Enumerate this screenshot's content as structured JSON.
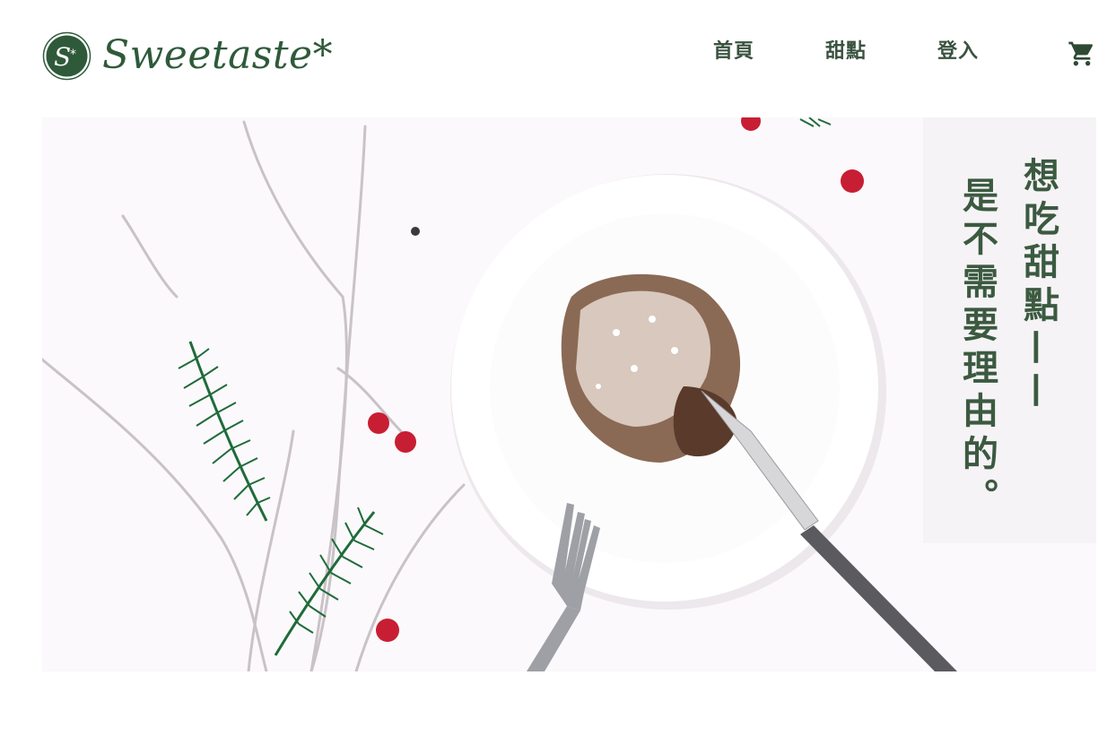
{
  "brand": {
    "name": "Sweetaste*",
    "mark_letter": "S*"
  },
  "nav": {
    "items": [
      {
        "label": "首頁"
      },
      {
        "label": "甜點"
      },
      {
        "label": "登入"
      }
    ]
  },
  "cart": {
    "icon": "cart-icon"
  },
  "hero": {
    "headline_line1": "想吃甜點——",
    "headline_line2": "是不需要理由的。"
  },
  "colors": {
    "brand_green": "#2f5a3a",
    "hero_bg": "#fbf9fb",
    "berry_red": "#c81e33",
    "pine_green": "#1f6b3a"
  }
}
